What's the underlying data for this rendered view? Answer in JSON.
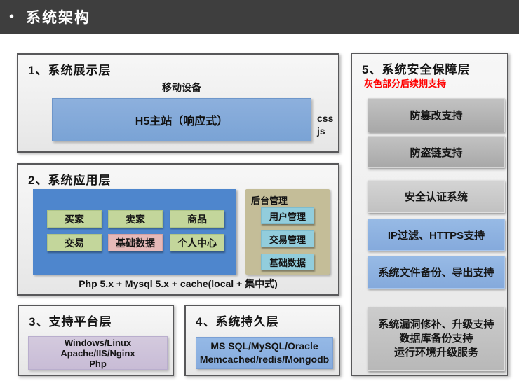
{
  "header": {
    "bullet": "•",
    "title": "系统架构"
  },
  "panels": {
    "display": {
      "title": "1、系统展示层",
      "device_label": "移动设备",
      "main_site": "H5主站（响应式）",
      "css_label": "css",
      "js_label": "js"
    },
    "application": {
      "title": "2、系统应用层",
      "modules": [
        {
          "label": "买家",
          "color": "green"
        },
        {
          "label": "卖家",
          "color": "green"
        },
        {
          "label": "商品",
          "color": "green"
        },
        {
          "label": "交易",
          "color": "green"
        },
        {
          "label": "基础数据",
          "color": "pink"
        },
        {
          "label": "个人中心",
          "color": "green"
        }
      ],
      "admin": {
        "title": "后台管理",
        "items": [
          "用户管理",
          "交易管理",
          "基础数据"
        ]
      },
      "tech_note": "Php 5.x + Mysql 5.x + cache(local + 集中式)"
    },
    "platform": {
      "title": "3、支持平台层",
      "lines": [
        "Windows/Linux",
        "Apache/IIS/Nginx",
        "Php"
      ]
    },
    "persistence": {
      "title": "4、系统持久层",
      "lines": [
        "MS SQL/MySQL/Oracle",
        "Memcached/redis/Mongodb"
      ]
    },
    "security": {
      "title": "5、系统安全保障层",
      "note": "灰色部分后续期支持",
      "items": [
        {
          "label": "防篡改支持",
          "style": "gray"
        },
        {
          "label": "防盗链支持",
          "style": "gray"
        },
        {
          "label": "安全认证系统",
          "style": "silver"
        },
        {
          "label": "IP过滤、HTTPS支持",
          "style": "blue"
        },
        {
          "label": "系统文件备份、导出支持",
          "style": "blue"
        }
      ],
      "bundle": {
        "style": "gray",
        "lines": [
          "系统漏洞修补、升级支持",
          "数据库备份支持",
          "运行环境升级服务"
        ]
      }
    }
  },
  "colors": {
    "header_bg": "#3e3e3e",
    "panel_bg": "#efefef",
    "panel_border": "#58585a",
    "blue_container": "#4e86cd",
    "h5_blue": "#81a8d8",
    "module_green": "#c3d69b",
    "module_pink": "#e6b9b8",
    "admin_tan": "#c4bd98",
    "admin_cyan": "#92cddc",
    "platform_purple": "#ccc1da",
    "persistence_blue": "#8db3e2",
    "security_gray": "#b3b3b3",
    "security_silver": "#cbcbcb",
    "security_blue": "#8db3e2",
    "note_red": "#ff0000"
  }
}
